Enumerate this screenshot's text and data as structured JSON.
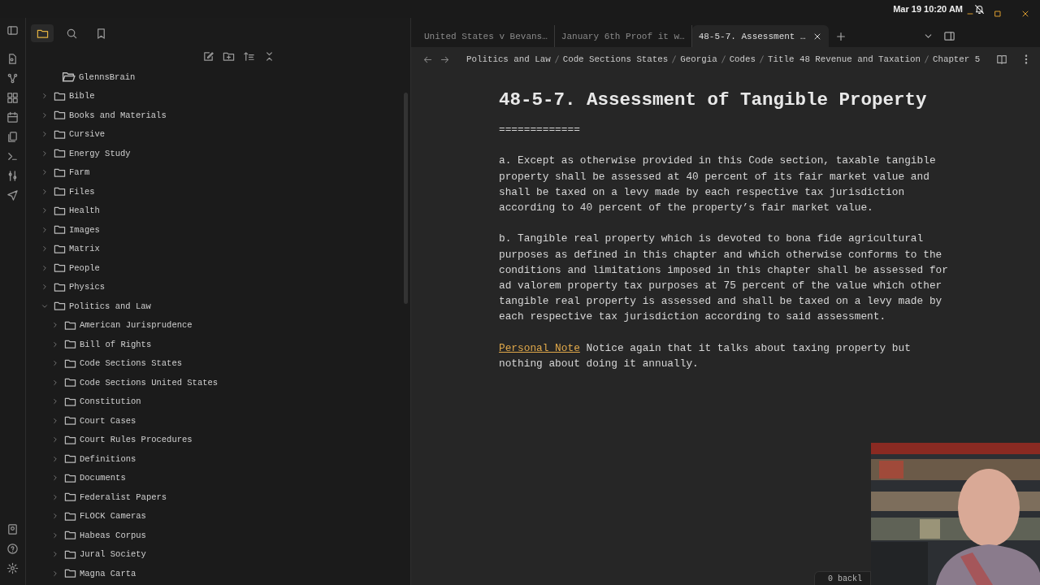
{
  "top_bar": {
    "clock": "Mar 19  10:20 AM"
  },
  "sidebar": {
    "header_tabs": [
      {
        "selected": true
      },
      {
        "selected": false
      },
      {
        "selected": false
      }
    ],
    "tree": [
      {
        "label": "GlennsBrain",
        "expanded": true,
        "children": [
          {
            "label": "Bible",
            "expanded": false
          },
          {
            "label": "Books and Materials",
            "expanded": false
          },
          {
            "label": "Cursive",
            "expanded": false
          },
          {
            "label": "Energy Study",
            "expanded": false
          },
          {
            "label": "Farm",
            "expanded": false
          },
          {
            "label": "Files",
            "expanded": false
          },
          {
            "label": "Health",
            "expanded": false
          },
          {
            "label": "Images",
            "expanded": false
          },
          {
            "label": "Matrix",
            "expanded": false
          },
          {
            "label": "People",
            "expanded": false
          },
          {
            "label": "Physics",
            "expanded": false
          },
          {
            "label": "Politics and Law",
            "expanded": true,
            "children": [
              {
                "label": "American Jurisprudence",
                "expanded": false
              },
              {
                "label": "Bill of Rights",
                "expanded": false
              },
              {
                "label": "Code Sections States",
                "expanded": false
              },
              {
                "label": "Code Sections United States",
                "expanded": false
              },
              {
                "label": "Constitution",
                "expanded": false
              },
              {
                "label": "Court Cases",
                "expanded": false
              },
              {
                "label": "Court Rules Procedures",
                "expanded": false
              },
              {
                "label": "Definitions",
                "expanded": false
              },
              {
                "label": "Documents",
                "expanded": false
              },
              {
                "label": "Federalist Papers",
                "expanded": false
              },
              {
                "label": "FLOCK Cameras",
                "expanded": false
              },
              {
                "label": "Habeas Corpus",
                "expanded": false
              },
              {
                "label": "Jural Society",
                "expanded": false
              },
              {
                "label": "Magna Carta",
                "expanded": false
              }
            ]
          }
        ]
      }
    ]
  },
  "tabs": [
    {
      "label": "United States v Bevans…",
      "selected": false
    },
    {
      "label": "January 6th Proof it w…",
      "selected": false
    },
    {
      "label": "48-5-7. Assessment …",
      "selected": true
    }
  ],
  "breadcrumb": [
    "Politics and Law",
    "Code Sections States",
    "Georgia",
    "Codes",
    "Title 48 Revenue and Taxation",
    "Chapter 5"
  ],
  "note": {
    "title": "48-5-7. Assessment of Tangible Property",
    "rule": "=============",
    "paragraphs": [
      {
        "text": "a. Except as otherwise provided in this Code section, taxable tangible property shall be assessed at 40 percent of its fair market value and shall be taxed on a levy made by each respective tax jurisdiction according to 40 percent of the property’s fair market value."
      },
      {
        "text": "b. Tangible real property which is devoted to bona fide agricultural purposes as defined in this chapter and which otherwise conforms to the conditions and limitations imposed in this chapter shall be assessed for ad valorem property tax purposes at 75 percent of the value which other tangible real property is assessed and shall be taxed on a levy made by each respective tax jurisdiction according to said assessment."
      },
      {
        "link": "Personal Note",
        "text": "Notice again that it talks about taxing property but nothing about doing it annually."
      }
    ]
  },
  "status_bar": {
    "backlinks": "0 backl"
  }
}
